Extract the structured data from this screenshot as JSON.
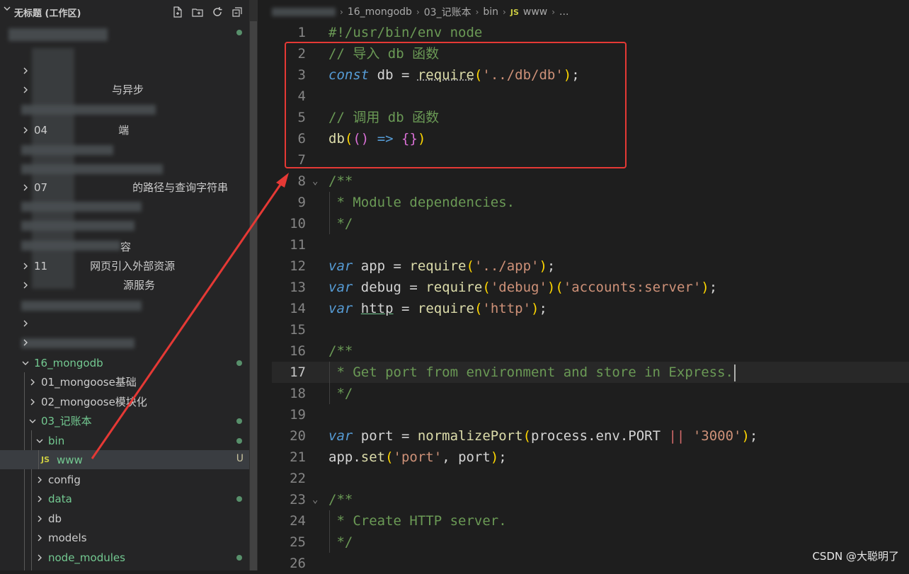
{
  "explorer": {
    "title": "无标题 (工作区)",
    "actions": [
      "new-file-icon",
      "new-folder-icon",
      "refresh-icon",
      "collapse-all-icon"
    ],
    "visible_labels": {
      "r5": "与异步",
      "r7": "04",
      "r8": "端",
      "r10": "07",
      "r10b": "的路径与查询字符串",
      "r13": "容",
      "r14": "11",
      "r14b": "网页引入外部资源",
      "r15": "源服务",
      "f16": "16_mongodb",
      "f16a": "01_mongoose基础",
      "f16b": "02_mongoose模块化",
      "f16c": "03_记账本",
      "bin": "bin",
      "www_icon": "JS",
      "www": "www",
      "www_status": "U",
      "config": "config",
      "data": "data",
      "db": "db",
      "models": "models",
      "node_modules": "node_modules"
    }
  },
  "breadcrumb": {
    "p1": "16_mongodb",
    "p2": "03_记账本",
    "p3": "bin",
    "icon": "JS",
    "p4": "www",
    "p5": "..."
  },
  "editor": {
    "lines": [
      {
        "n": "1",
        "t": "#!/usr/bin/env node"
      },
      {
        "n": "2",
        "t": "// 导入 db 函数"
      },
      {
        "n": "3",
        "t": "const db = require('../db/db');"
      },
      {
        "n": "4",
        "t": ""
      },
      {
        "n": "5",
        "t": "// 调用 db 函数"
      },
      {
        "n": "6",
        "t": "db(() => {})"
      },
      {
        "n": "7",
        "t": ""
      },
      {
        "n": "8",
        "t": "/**"
      },
      {
        "n": "9",
        "t": " * Module dependencies."
      },
      {
        "n": "10",
        "t": " */"
      },
      {
        "n": "11",
        "t": ""
      },
      {
        "n": "12",
        "t": "var app = require('../app');"
      },
      {
        "n": "13",
        "t": "var debug = require('debug')('accounts:server');"
      },
      {
        "n": "14",
        "t": "var http = require('http');"
      },
      {
        "n": "15",
        "t": ""
      },
      {
        "n": "16",
        "t": "/**"
      },
      {
        "n": "17",
        "t": " * Get port from environment and store in Express."
      },
      {
        "n": "18",
        "t": " */"
      },
      {
        "n": "19",
        "t": ""
      },
      {
        "n": "20",
        "t": "var port = normalizePort(process.env.PORT || '3000');"
      },
      {
        "n": "21",
        "t": "app.set('port', port);"
      },
      {
        "n": "22",
        "t": ""
      },
      {
        "n": "23",
        "t": "/**"
      },
      {
        "n": "24",
        "t": " * Create HTTP server."
      },
      {
        "n": "25",
        "t": " */"
      },
      {
        "n": "26",
        "t": ""
      }
    ]
  },
  "watermark": "CSDN @大聪明了",
  "colors": {
    "annotation": "#e53935",
    "git_untracked": "#73c991"
  }
}
